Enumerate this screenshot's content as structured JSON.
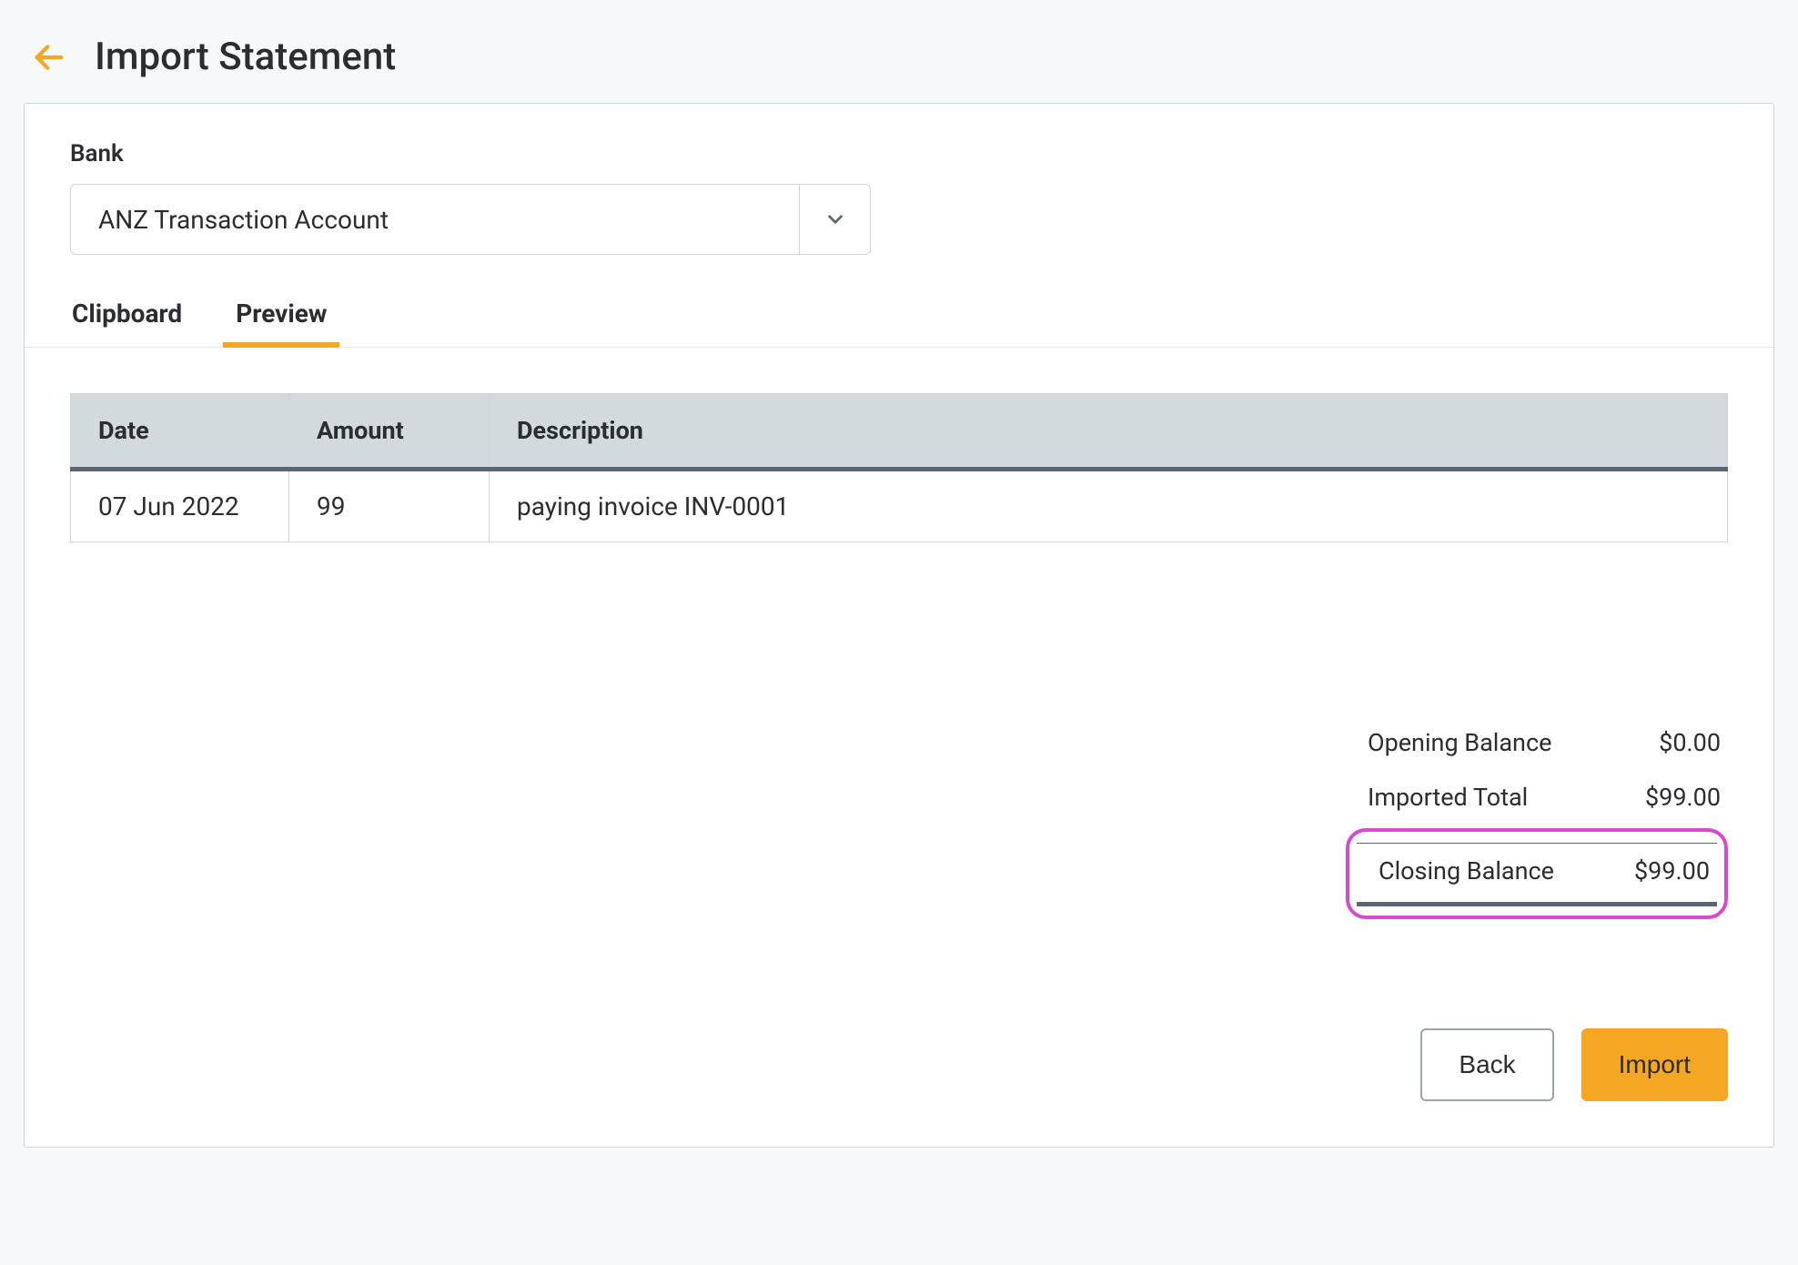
{
  "header": {
    "title": "Import Statement"
  },
  "form": {
    "bank_label": "Bank",
    "bank_value": "ANZ Transaction Account"
  },
  "tabs": {
    "clipboard": "Clipboard",
    "preview": "Preview",
    "active": "preview"
  },
  "table": {
    "columns": {
      "date": "Date",
      "amount": "Amount",
      "description": "Description"
    },
    "rows": [
      {
        "date": "07 Jun 2022",
        "amount": "99",
        "description": "paying invoice INV-0001"
      }
    ]
  },
  "summary": {
    "opening_label": "Opening Balance",
    "opening_value": "$0.00",
    "imported_label": "Imported Total",
    "imported_value": "$99.00",
    "closing_label": "Closing Balance",
    "closing_value": "$99.00"
  },
  "actions": {
    "back": "Back",
    "import": "Import"
  },
  "colors": {
    "accent": "#f5a623",
    "highlight": "#d649d0"
  }
}
